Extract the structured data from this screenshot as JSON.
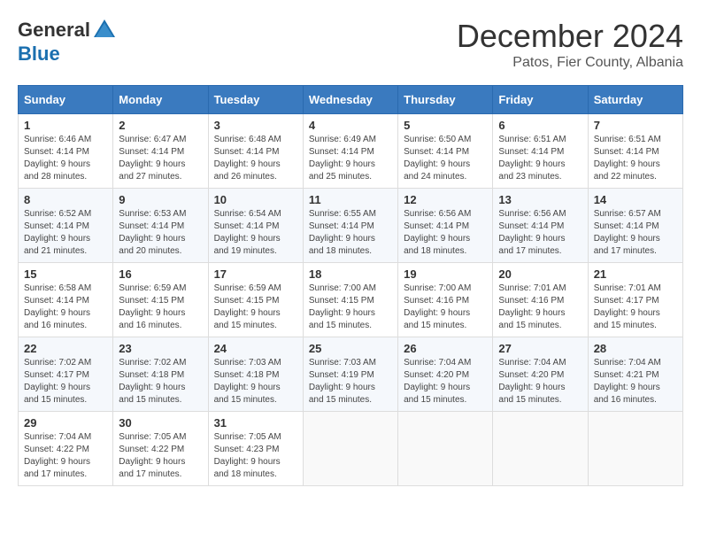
{
  "header": {
    "logo_general": "General",
    "logo_blue": "Blue",
    "month_title": "December 2024",
    "location": "Patos, Fier County, Albania"
  },
  "calendar": {
    "days_of_week": [
      "Sunday",
      "Monday",
      "Tuesday",
      "Wednesday",
      "Thursday",
      "Friday",
      "Saturday"
    ],
    "weeks": [
      [
        {
          "day": "1",
          "sunrise": "6:46 AM",
          "sunset": "4:14 PM",
          "daylight": "9 hours and 28 minutes."
        },
        {
          "day": "2",
          "sunrise": "6:47 AM",
          "sunset": "4:14 PM",
          "daylight": "9 hours and 27 minutes."
        },
        {
          "day": "3",
          "sunrise": "6:48 AM",
          "sunset": "4:14 PM",
          "daylight": "9 hours and 26 minutes."
        },
        {
          "day": "4",
          "sunrise": "6:49 AM",
          "sunset": "4:14 PM",
          "daylight": "9 hours and 25 minutes."
        },
        {
          "day": "5",
          "sunrise": "6:50 AM",
          "sunset": "4:14 PM",
          "daylight": "9 hours and 24 minutes."
        },
        {
          "day": "6",
          "sunrise": "6:51 AM",
          "sunset": "4:14 PM",
          "daylight": "9 hours and 23 minutes."
        },
        {
          "day": "7",
          "sunrise": "6:51 AM",
          "sunset": "4:14 PM",
          "daylight": "9 hours and 22 minutes."
        }
      ],
      [
        {
          "day": "8",
          "sunrise": "6:52 AM",
          "sunset": "4:14 PM",
          "daylight": "9 hours and 21 minutes."
        },
        {
          "day": "9",
          "sunrise": "6:53 AM",
          "sunset": "4:14 PM",
          "daylight": "9 hours and 20 minutes."
        },
        {
          "day": "10",
          "sunrise": "6:54 AM",
          "sunset": "4:14 PM",
          "daylight": "9 hours and 19 minutes."
        },
        {
          "day": "11",
          "sunrise": "6:55 AM",
          "sunset": "4:14 PM",
          "daylight": "9 hours and 18 minutes."
        },
        {
          "day": "12",
          "sunrise": "6:56 AM",
          "sunset": "4:14 PM",
          "daylight": "9 hours and 18 minutes."
        },
        {
          "day": "13",
          "sunrise": "6:56 AM",
          "sunset": "4:14 PM",
          "daylight": "9 hours and 17 minutes."
        },
        {
          "day": "14",
          "sunrise": "6:57 AM",
          "sunset": "4:14 PM",
          "daylight": "9 hours and 17 minutes."
        }
      ],
      [
        {
          "day": "15",
          "sunrise": "6:58 AM",
          "sunset": "4:14 PM",
          "daylight": "9 hours and 16 minutes."
        },
        {
          "day": "16",
          "sunrise": "6:59 AM",
          "sunset": "4:15 PM",
          "daylight": "9 hours and 16 minutes."
        },
        {
          "day": "17",
          "sunrise": "6:59 AM",
          "sunset": "4:15 PM",
          "daylight": "9 hours and 15 minutes."
        },
        {
          "day": "18",
          "sunrise": "7:00 AM",
          "sunset": "4:15 PM",
          "daylight": "9 hours and 15 minutes."
        },
        {
          "day": "19",
          "sunrise": "7:00 AM",
          "sunset": "4:16 PM",
          "daylight": "9 hours and 15 minutes."
        },
        {
          "day": "20",
          "sunrise": "7:01 AM",
          "sunset": "4:16 PM",
          "daylight": "9 hours and 15 minutes."
        },
        {
          "day": "21",
          "sunrise": "7:01 AM",
          "sunset": "4:17 PM",
          "daylight": "9 hours and 15 minutes."
        }
      ],
      [
        {
          "day": "22",
          "sunrise": "7:02 AM",
          "sunset": "4:17 PM",
          "daylight": "9 hours and 15 minutes."
        },
        {
          "day": "23",
          "sunrise": "7:02 AM",
          "sunset": "4:18 PM",
          "daylight": "9 hours and 15 minutes."
        },
        {
          "day": "24",
          "sunrise": "7:03 AM",
          "sunset": "4:18 PM",
          "daylight": "9 hours and 15 minutes."
        },
        {
          "day": "25",
          "sunrise": "7:03 AM",
          "sunset": "4:19 PM",
          "daylight": "9 hours and 15 minutes."
        },
        {
          "day": "26",
          "sunrise": "7:04 AM",
          "sunset": "4:20 PM",
          "daylight": "9 hours and 15 minutes."
        },
        {
          "day": "27",
          "sunrise": "7:04 AM",
          "sunset": "4:20 PM",
          "daylight": "9 hours and 15 minutes."
        },
        {
          "day": "28",
          "sunrise": "7:04 AM",
          "sunset": "4:21 PM",
          "daylight": "9 hours and 16 minutes."
        }
      ],
      [
        {
          "day": "29",
          "sunrise": "7:04 AM",
          "sunset": "4:22 PM",
          "daylight": "9 hours and 17 minutes."
        },
        {
          "day": "30",
          "sunrise": "7:05 AM",
          "sunset": "4:22 PM",
          "daylight": "9 hours and 17 minutes."
        },
        {
          "day": "31",
          "sunrise": "7:05 AM",
          "sunset": "4:23 PM",
          "daylight": "9 hours and 18 minutes."
        },
        null,
        null,
        null,
        null
      ]
    ],
    "labels": {
      "sunrise": "Sunrise:",
      "sunset": "Sunset:",
      "daylight": "Daylight:"
    }
  }
}
